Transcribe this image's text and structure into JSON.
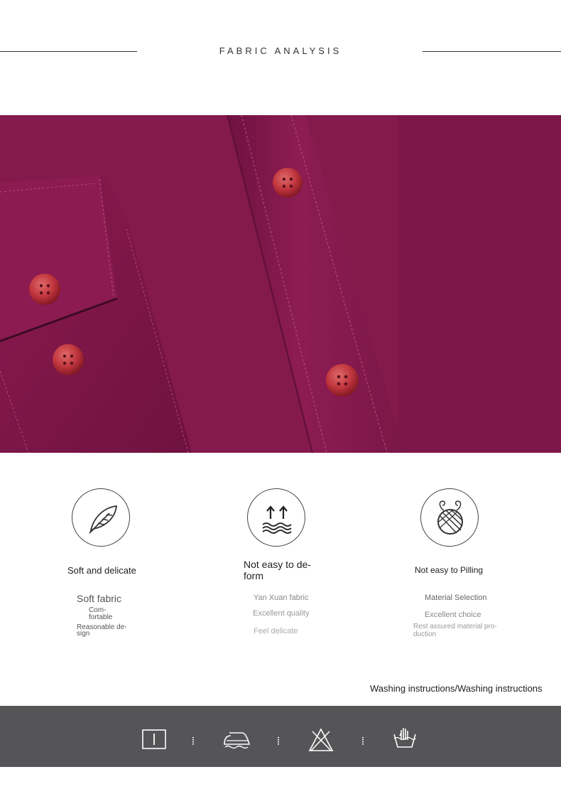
{
  "header": {
    "title": "FABRIC ANALYSIS"
  },
  "features": [
    {
      "icon": "feather-icon",
      "title": "Soft and delicate",
      "lines": [
        "Soft fabric",
        "Com-",
        "fortable",
        "Reasonable de-",
        "sign"
      ]
    },
    {
      "icon": "arrows-waves-icon",
      "title": "Not easy to de-form",
      "title_line1": "Not easy to de-",
      "title_line2": "form",
      "lines": [
        "Yan Xuan fabric",
        "Excellent quality",
        "Feel delicate"
      ]
    },
    {
      "icon": "yarn-ball-icon",
      "title": "Not easy to Pilling",
      "lines": [
        "Material Selection",
        "Excellent choice",
        "Rest assured material pro-",
        "duction"
      ]
    }
  ],
  "washing": {
    "title": "Washing instructions/Washing instructions",
    "icons": [
      "dry-icon",
      "iron-icon",
      "no-bleach-icon",
      "hand-wash-icon"
    ]
  },
  "colors": {
    "fabric": "#861a4d",
    "button": "#c0353d",
    "bar": "#555558"
  }
}
